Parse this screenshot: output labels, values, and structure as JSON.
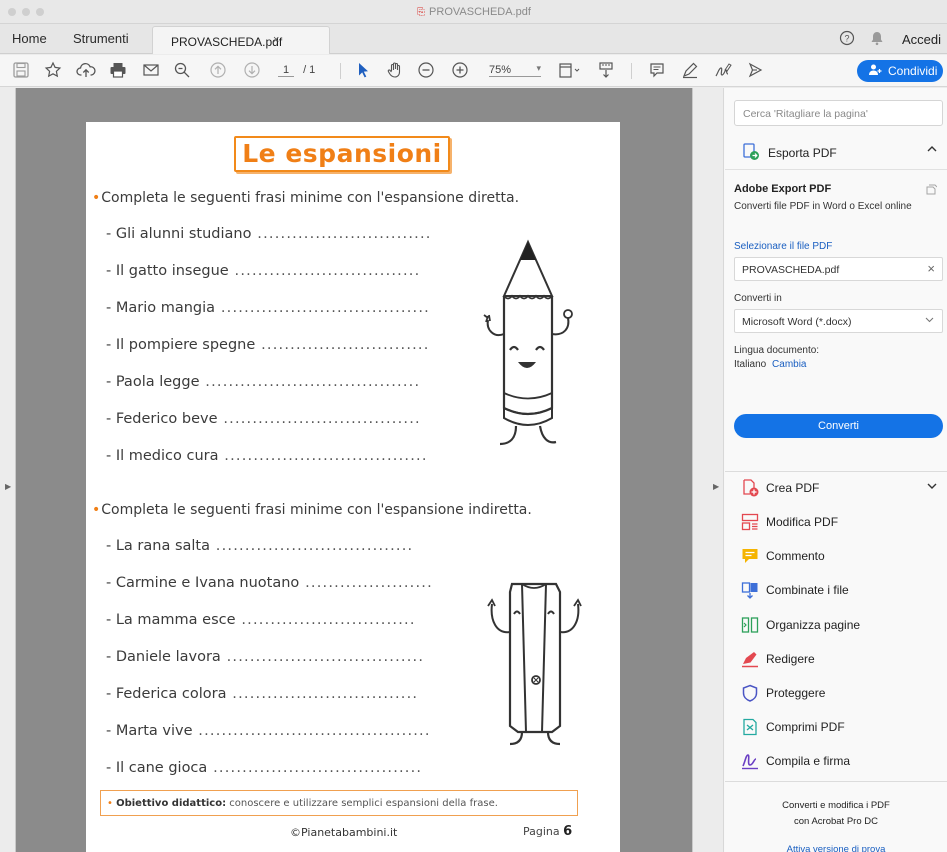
{
  "window": {
    "title": "PROVASCHEDA.pdf"
  },
  "tabs": {
    "home": "Home",
    "tools": "Strumenti",
    "document": "PROVASCHEDA.pdf",
    "close": "×",
    "signin": "Accedi"
  },
  "toolbar": {
    "page_current": "1",
    "page_total": "/ 1",
    "zoom": "75%",
    "share_label": "Condividi"
  },
  "document": {
    "heading": "Le espansioni",
    "section1": {
      "instruction": "Completa le seguenti frasi minime con l'espansione diretta.",
      "items": [
        "- Gli alunni studiano",
        "- Il gatto insegue",
        "- Mario mangia",
        "- Il pompiere spegne",
        "- Paola legge",
        "- Federico beve",
        "- Il medico cura"
      ]
    },
    "section2": {
      "instruction": "Completa le seguenti frasi minime con l'espansione indiretta.",
      "items": [
        "- La rana salta",
        "- Carmine e Ivana nuotano",
        "- La mamma esce",
        "- Daniele lavora",
        "- Federica colora",
        "- Marta vive",
        "- Il cane gioca"
      ]
    },
    "goal_label": "Obiettivo didattico:",
    "goal_text": " conoscere e utilizzare semplici espansioni della frase.",
    "footer_site": "©Pianetabambini.it",
    "footer_page_label": "Pagina",
    "footer_page_num": "6"
  },
  "panel": {
    "search_placeholder": "Cerca 'Ritagliare la pagina'",
    "export_header": "Esporta PDF",
    "export_title": "Adobe Export PDF",
    "export_subtitle": "Converti file PDF in Word o Excel online",
    "select_file_link": "Selezionare il file PDF",
    "selected_file": "PROVASCHEDA.pdf",
    "convert_to_label": "Converti in",
    "convert_to_value": "Microsoft Word (*.docx)",
    "language_label": "Lingua documento:",
    "language_value": "Italiano",
    "language_change": "Cambia",
    "convert_button": "Converti",
    "tools": [
      {
        "label": "Crea PDF",
        "icon": "create-pdf-icon",
        "color": "#e34850"
      },
      {
        "label": "Modifica PDF",
        "icon": "edit-pdf-icon",
        "color": "#e34850"
      },
      {
        "label": "Commento",
        "icon": "comment-icon",
        "color": "#f5b400"
      },
      {
        "label": "Combinate i file",
        "icon": "combine-files-icon",
        "color": "#3d6fd8"
      },
      {
        "label": "Organizza pagine",
        "icon": "organize-pages-icon",
        "color": "#2da05a"
      },
      {
        "label": "Redigere",
        "icon": "redact-icon",
        "color": "#e34850"
      },
      {
        "label": "Proteggere",
        "icon": "protect-icon",
        "color": "#4a55c4"
      },
      {
        "label": "Comprimi PDF",
        "icon": "compress-pdf-icon",
        "color": "#23a9a0"
      },
      {
        "label": "Compila e firma",
        "icon": "fill-sign-icon",
        "color": "#6a3fc4"
      }
    ],
    "promo_line1": "Converti e modifica i PDF",
    "promo_line2": "con Acrobat Pro DC",
    "trial_link": "Attiva versione di prova"
  },
  "colors": {
    "accent": "#1473e6",
    "heading_orange": "#f07f16",
    "doc_background": "#8b8b8b"
  }
}
